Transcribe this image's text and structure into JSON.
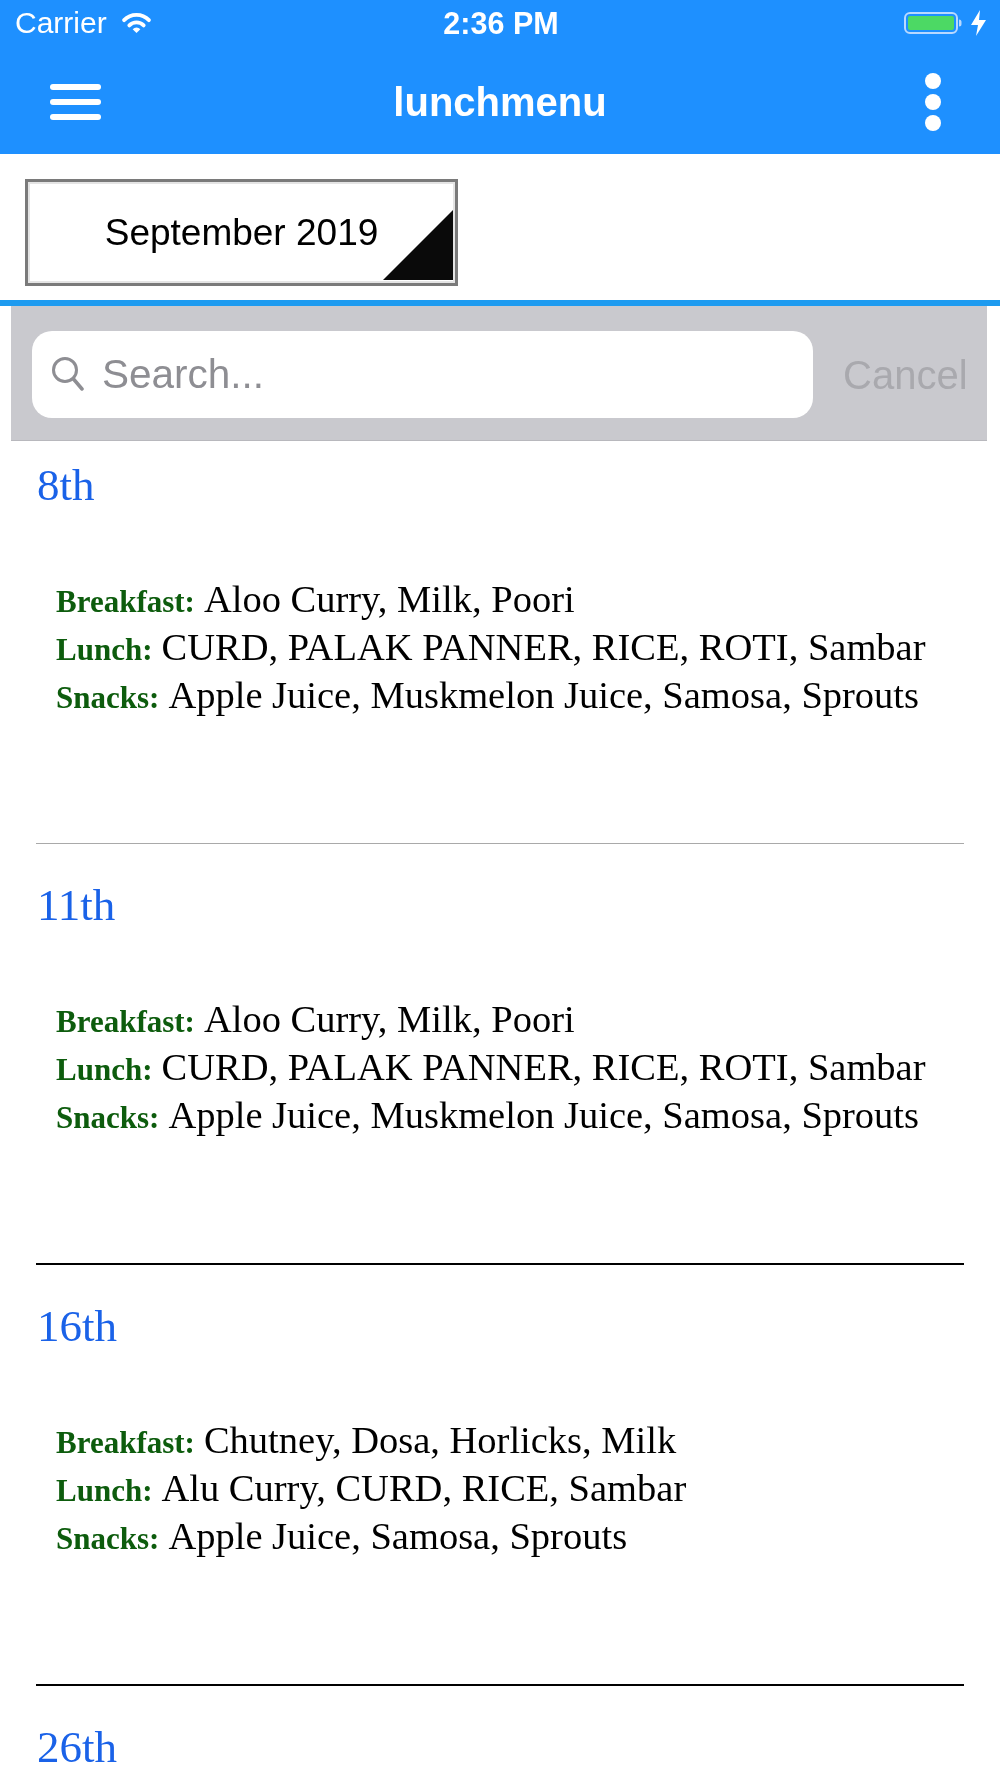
{
  "status_bar": {
    "carrier": "Carrier",
    "time": "2:36 PM"
  },
  "nav_bar": {
    "title": "lunchmenu"
  },
  "month_picker": {
    "value": "September 2019"
  },
  "search": {
    "placeholder": "Search...",
    "cancel": "Cancel"
  },
  "days": [
    {
      "date": "8th",
      "meals": [
        {
          "label": "Breakfast:",
          "items": "Aloo Curry, Milk, Poori"
        },
        {
          "label": "Lunch:",
          "items": "CURD, PALAK PANNER, RICE, ROTI, Sambar"
        },
        {
          "label": "Snacks:",
          "items": "Apple Juice, Muskmelon Juice, Samosa, Sprouts"
        }
      ]
    },
    {
      "date": "11th",
      "meals": [
        {
          "label": "Breakfast:",
          "items": "Aloo Curry, Milk, Poori"
        },
        {
          "label": "Lunch:",
          "items": "CURD, PALAK PANNER, RICE, ROTI, Sambar"
        },
        {
          "label": "Snacks:",
          "items": "Apple Juice, Muskmelon Juice, Samosa, Sprouts"
        }
      ]
    },
    {
      "date": "16th",
      "meals": [
        {
          "label": "Breakfast:",
          "items": "Chutney, Dosa, Horlicks, Milk"
        },
        {
          "label": "Lunch:",
          "items": "Alu Curry, CURD, RICE, Sambar"
        },
        {
          "label": "Snacks:",
          "items": "Apple Juice, Samosa, Sprouts"
        }
      ]
    },
    {
      "date": "26th"
    }
  ]
}
